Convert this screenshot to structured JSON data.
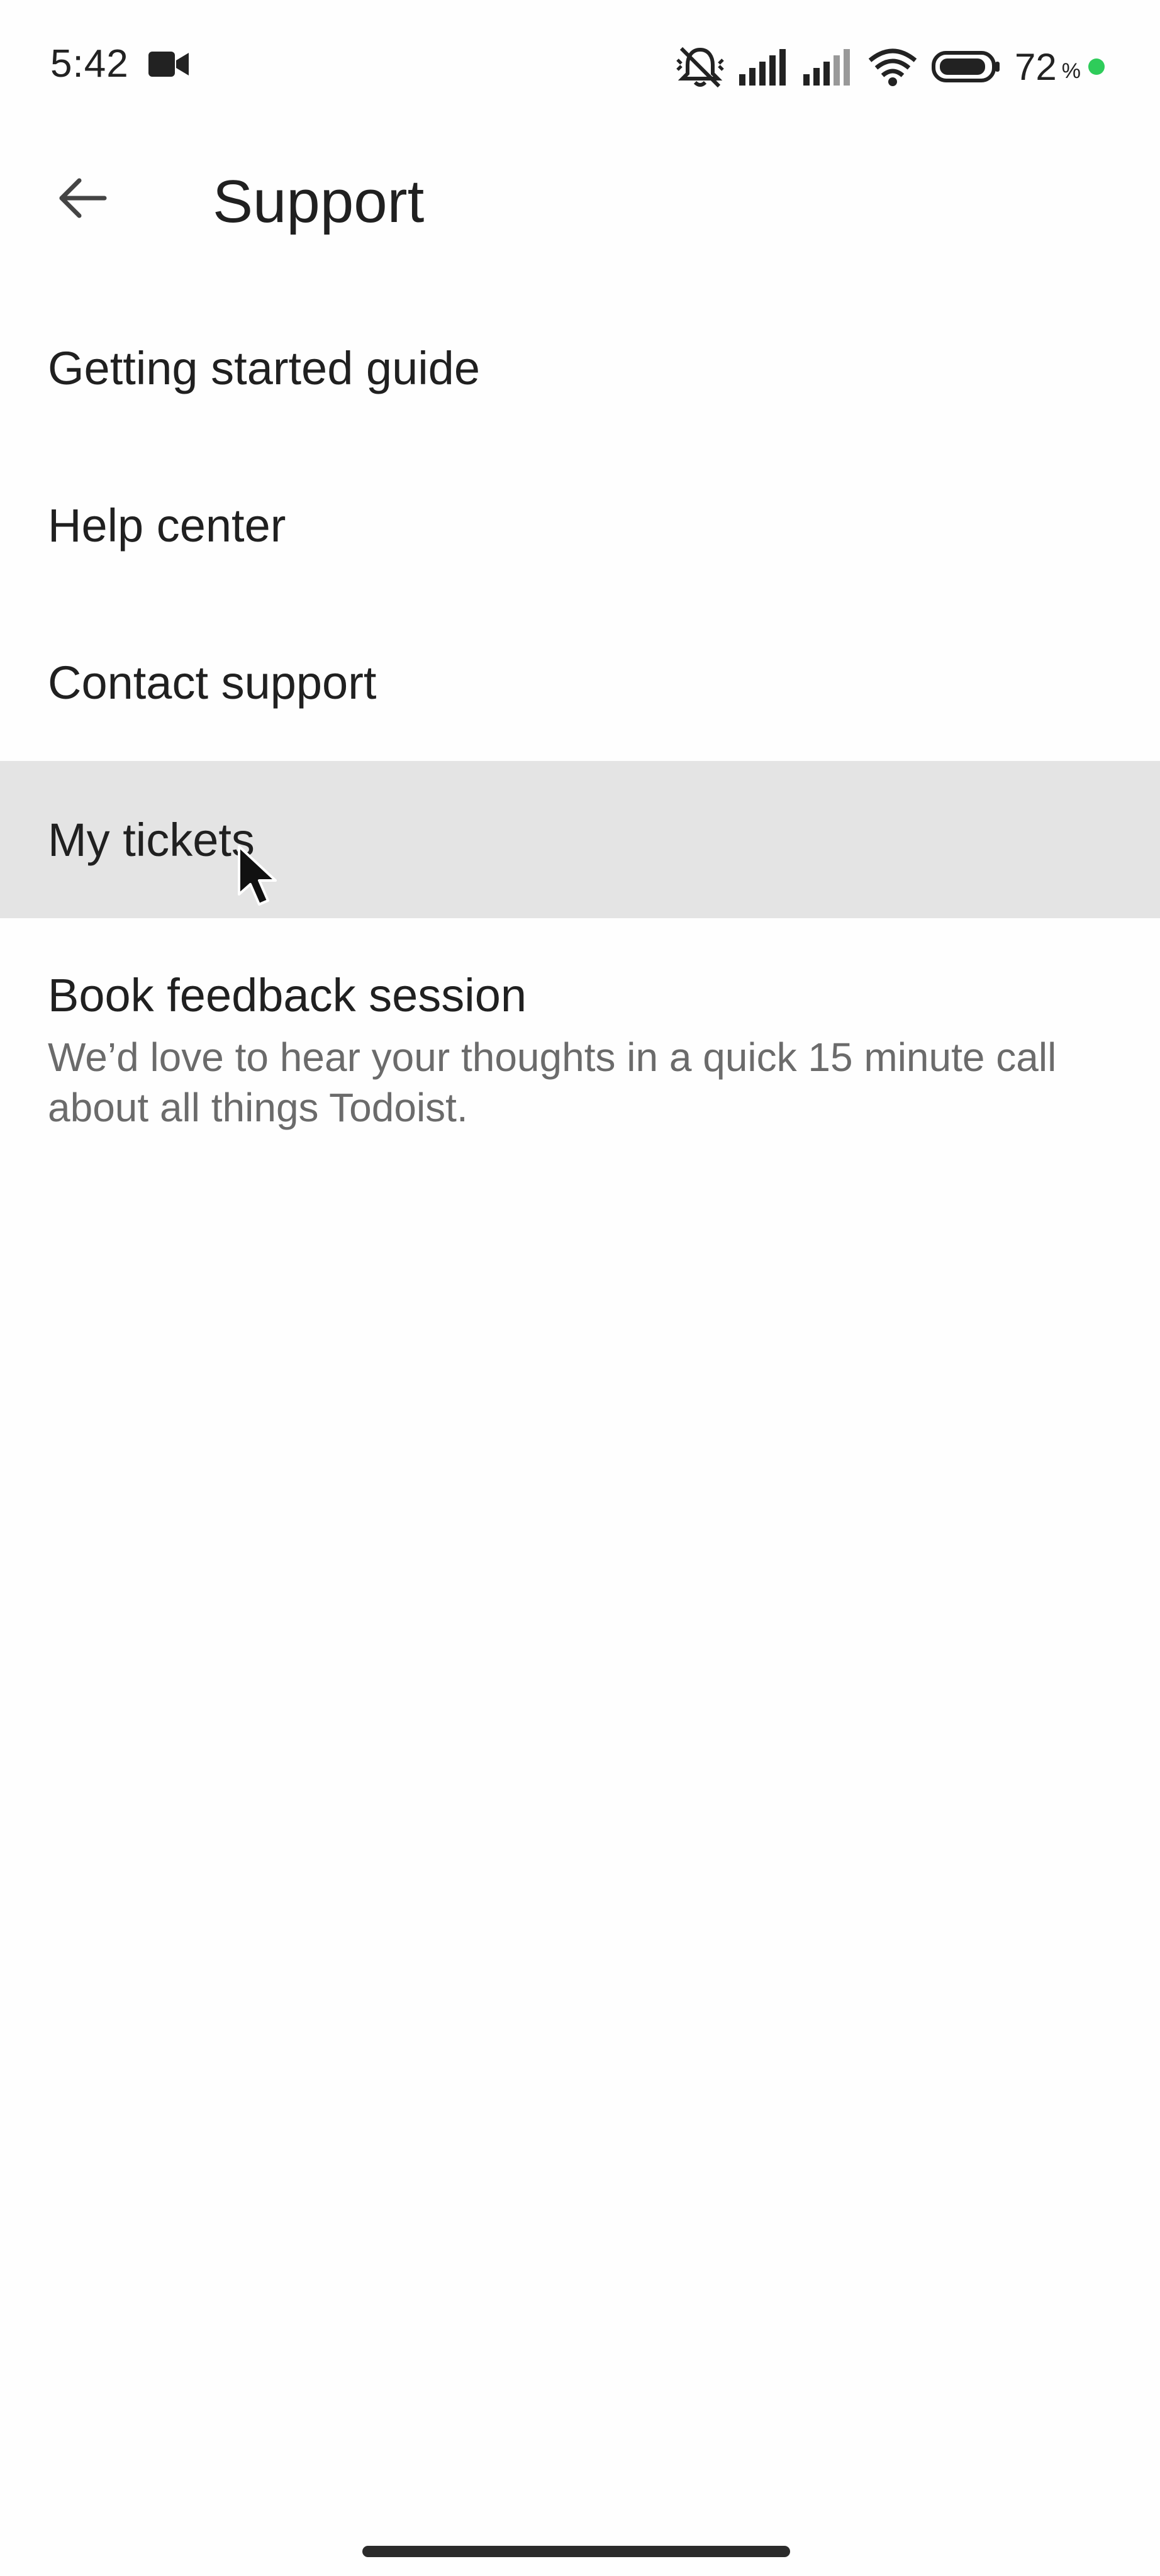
{
  "status_bar": {
    "time": "5:42",
    "battery_level": "72",
    "battery_unit": "%",
    "icons": [
      "video-camera-icon",
      "silent-mode-icon",
      "signal-icon",
      "signal-icon",
      "wifi-icon",
      "battery-icon",
      "charging-dot-icon"
    ],
    "charge_color": "#2ecc5a"
  },
  "header": {
    "title": "Support",
    "back_icon": "arrow-left-icon"
  },
  "menu": {
    "items": [
      {
        "label": "Getting started guide"
      },
      {
        "label": "Help center"
      },
      {
        "label": "Contact support"
      },
      {
        "label": "My tickets",
        "highlighted": true
      },
      {
        "label": "Book feedback session",
        "description": "We’d love to hear your thoughts in a quick 15 minute call about all things Todoist."
      }
    ]
  },
  "colors": {
    "highlight_bg": "#e4e4e4",
    "text_primary": "#202020",
    "text_secondary": "#6b6b6b"
  }
}
